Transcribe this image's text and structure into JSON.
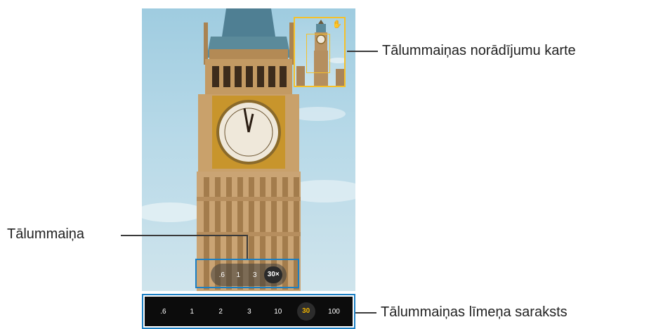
{
  "camera": {
    "zoom_pill": {
      "options": [
        ".6",
        "1",
        "3",
        "30×"
      ],
      "active_index": 3
    },
    "zoom_list": {
      "levels": [
        ".6",
        "1",
        "2",
        "3",
        "10",
        "30",
        "100"
      ],
      "active_index": 5
    },
    "zoom_map": {
      "lock_icon": "hand-lock-icon"
    }
  },
  "callouts": {
    "zoom_map_label": "Tālummaiņas norādījumu karte",
    "zoom_label": "Tālummaiņa",
    "zoom_list_label": "Tālummaiņas līmeņa saraksts"
  },
  "colors": {
    "highlight_box": "#1c7fc3",
    "zoom_map_border": "#f5c02a",
    "active_level": "#f0b400"
  }
}
